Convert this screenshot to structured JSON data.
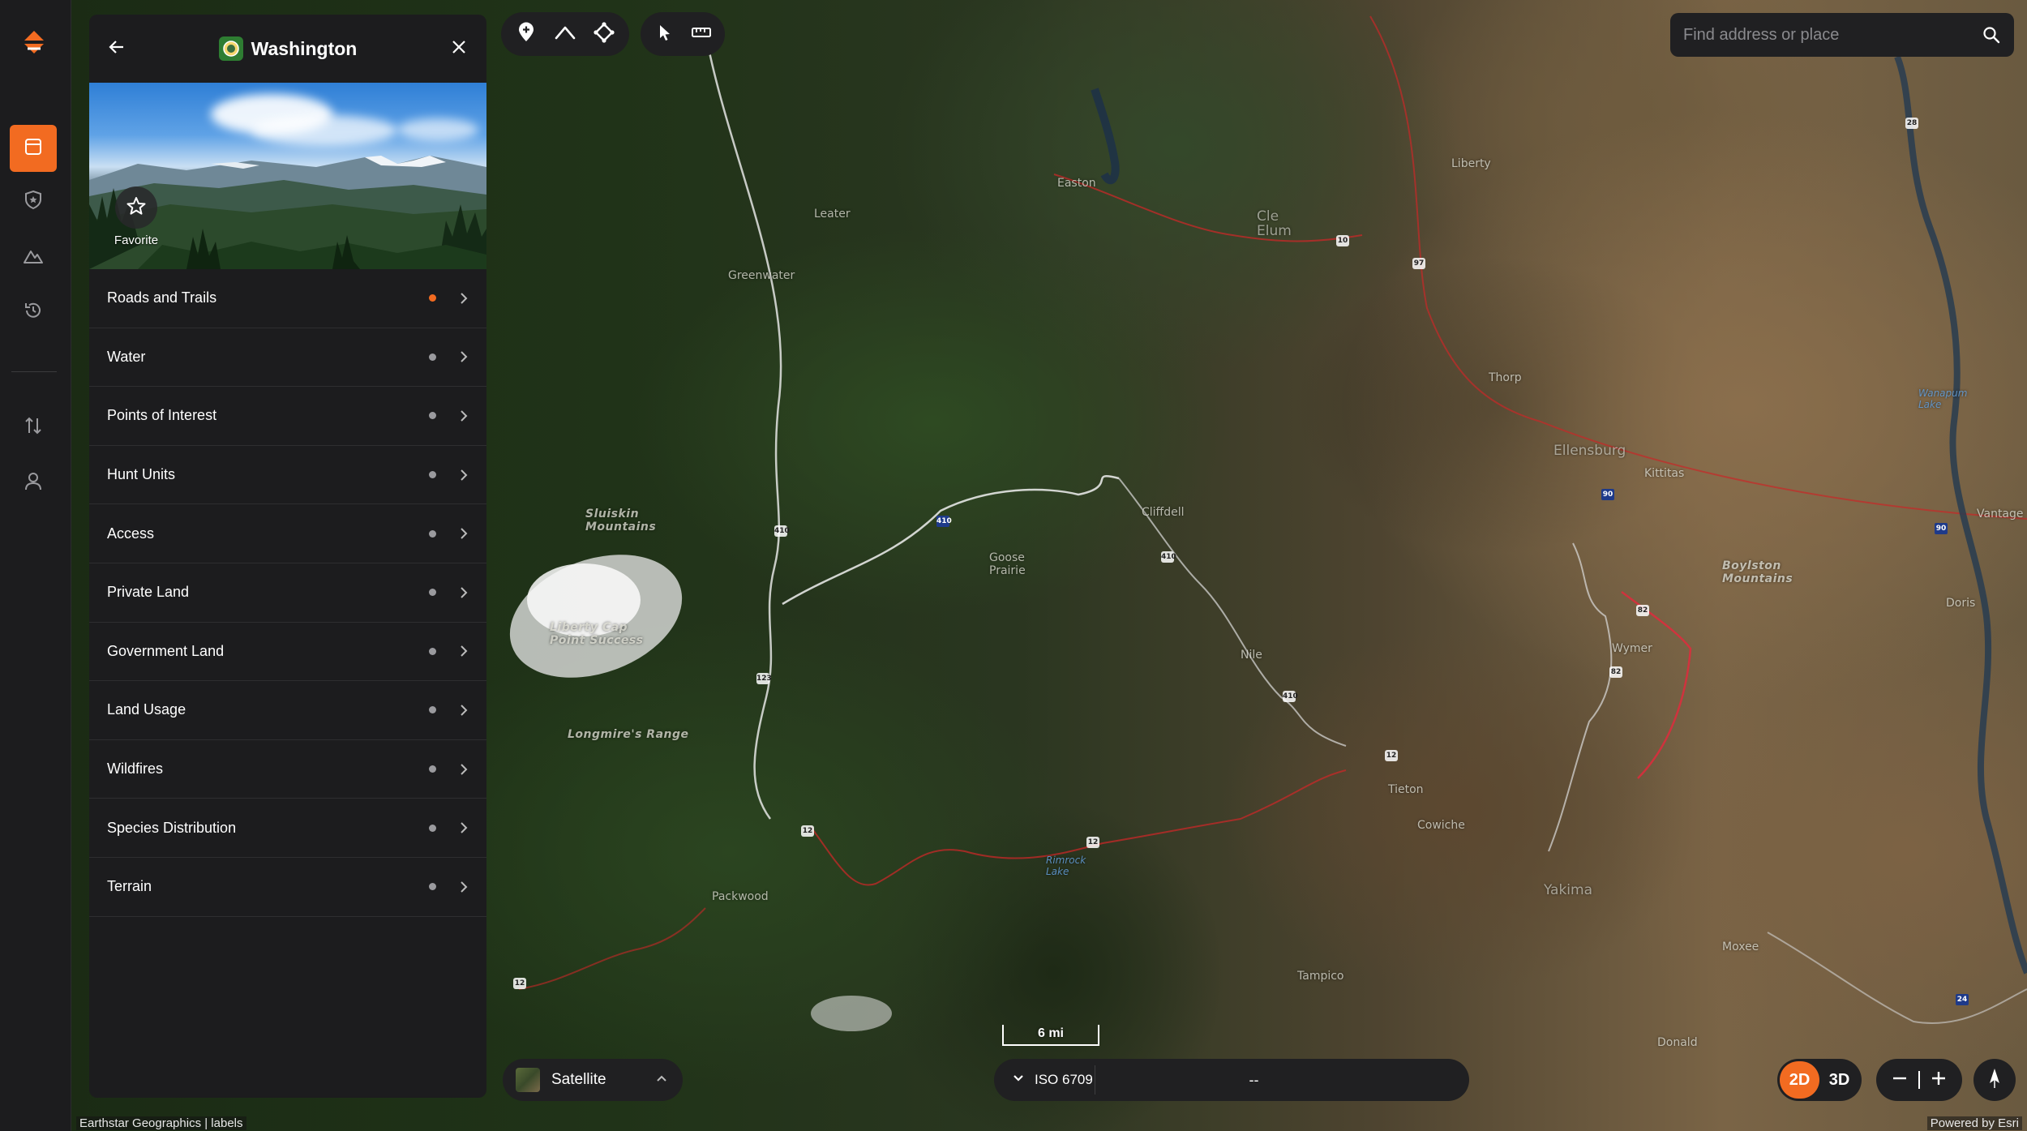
{
  "panel": {
    "title": "Washington",
    "favorite_label": "Favorite",
    "layers": [
      {
        "label": "Roads and Trails",
        "active": true
      },
      {
        "label": "Water",
        "active": false
      },
      {
        "label": "Points of Interest",
        "active": false
      },
      {
        "label": "Hunt Units",
        "active": false
      },
      {
        "label": "Access",
        "active": false
      },
      {
        "label": "Private Land",
        "active": false
      },
      {
        "label": "Government Land",
        "active": false
      },
      {
        "label": "Land Usage",
        "active": false
      },
      {
        "label": "Wildfires",
        "active": false
      },
      {
        "label": "Species Distribution",
        "active": false
      },
      {
        "label": "Terrain",
        "active": false
      }
    ]
  },
  "search": {
    "placeholder": "Find address or place"
  },
  "basemap": {
    "label": "Satellite"
  },
  "scale": {
    "label": "6 mi"
  },
  "iso": {
    "label": "ISO 6709",
    "value": "--"
  },
  "view_toggle": {
    "two_d": "2D",
    "three_d": "3D"
  },
  "attribution": {
    "left": "Earthstar Geographics | labels",
    "right": "Powered by Esri"
  },
  "map": {
    "labels": [
      {
        "text": "Sluiskin\nMountains",
        "style": "italic"
      },
      {
        "text": "Liberty Cap\nPoint Success",
        "style": "italic"
      },
      {
        "text": "Longmire's Range",
        "style": "italic"
      },
      {
        "text": "Goose\nPrairie",
        "style": "plain"
      },
      {
        "text": "Boylston\nMountains",
        "style": "italic"
      },
      {
        "text": "Ellensburg",
        "style": "big"
      },
      {
        "text": "Cle\nElum",
        "style": "big"
      },
      {
        "text": "Wymer",
        "style": "plain"
      },
      {
        "text": "Easton",
        "style": "plain"
      },
      {
        "text": "Liberty",
        "style": "plain"
      },
      {
        "text": "Leater",
        "style": "plain"
      },
      {
        "text": "Cliffdell",
        "style": "plain"
      },
      {
        "text": "Nile",
        "style": "plain"
      },
      {
        "text": "Tampico",
        "style": "plain"
      },
      {
        "text": "Yakima",
        "style": "big"
      },
      {
        "text": "Greenwater",
        "style": "plain"
      },
      {
        "text": "Packwood",
        "style": "plain"
      },
      {
        "text": "Kittitas",
        "style": "plain"
      },
      {
        "text": "Vantage",
        "style": "plain"
      },
      {
        "text": "Wanapum\nLake",
        "style": "water"
      },
      {
        "text": "Rimrock\nLake",
        "style": "water"
      },
      {
        "text": "Doris",
        "style": "plain"
      },
      {
        "text": "Thorp",
        "style": "plain"
      },
      {
        "text": "Donald",
        "style": "plain"
      },
      {
        "text": "Cowiche",
        "style": "plain"
      },
      {
        "text": "Moxee",
        "style": "plain"
      },
      {
        "text": "Tieton",
        "style": "plain"
      }
    ]
  },
  "colors": {
    "accent": "#f26b21",
    "panel_bg": "#1c1c1e",
    "control_bg": "#202022"
  },
  "icons": {
    "logo": "onx-logo-icon",
    "rail": [
      "layers-icon",
      "shield-icon",
      "terrain-icon",
      "history-icon",
      "transfer-icon",
      "profile-icon"
    ]
  }
}
